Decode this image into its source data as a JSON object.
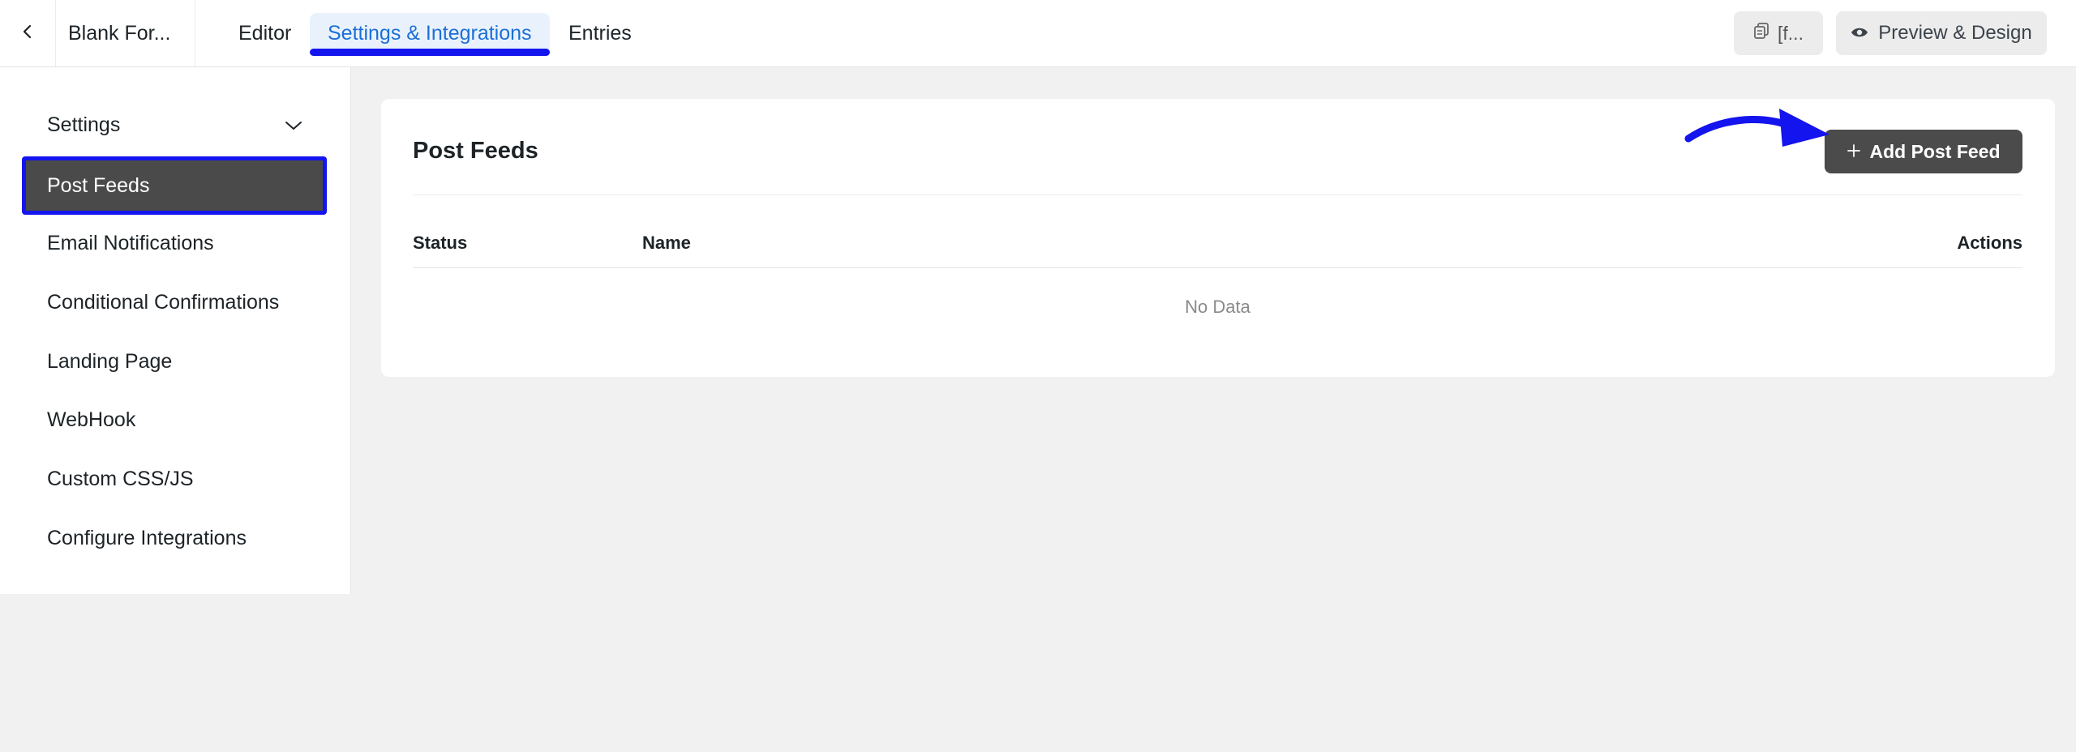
{
  "topbar": {
    "form_title": "Blank For...",
    "tabs": [
      {
        "label": "Editor"
      },
      {
        "label": "Settings & Integrations"
      },
      {
        "label": "Entries"
      }
    ],
    "shortcode_label": "[f...",
    "preview_label": "Preview & Design"
  },
  "sidebar": {
    "settings_label": "Settings",
    "items": [
      {
        "label": "Post Feeds"
      },
      {
        "label": "Email Notifications"
      },
      {
        "label": "Conditional Confirmations"
      },
      {
        "label": "Landing Page"
      },
      {
        "label": "WebHook"
      },
      {
        "label": "Custom CSS/JS"
      },
      {
        "label": "Configure Integrations"
      }
    ]
  },
  "main": {
    "title": "Post Feeds",
    "add_button_label": "Add Post Feed",
    "columns": [
      "Status",
      "Name",
      "Actions"
    ],
    "empty_text": "No Data"
  },
  "colors": {
    "accent": "#1c6fd6",
    "highlight": "#1414ee",
    "active_item_bg": "#4a4a4a"
  }
}
